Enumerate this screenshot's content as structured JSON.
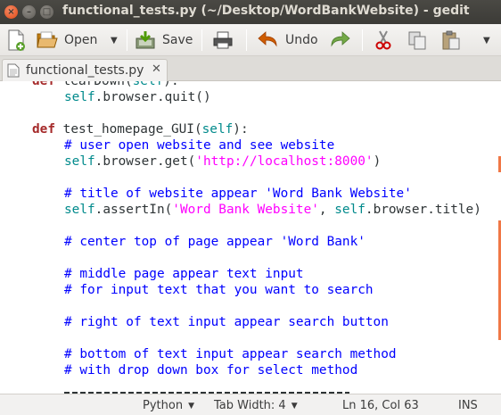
{
  "window": {
    "title": "functional_tests.py (~/Desktop/WordBankWebsite) - gedit"
  },
  "toolbar": {
    "open_label": "Open",
    "save_label": "Save",
    "undo_label": "Undo"
  },
  "tab": {
    "label": "functional_tests.py",
    "close": "✕"
  },
  "code": {
    "l0_kw": "def",
    "l0_name": " tearDown(",
    "l0_self": "self",
    "l0_end": "):",
    "l1_self": "self",
    "l1_rest": ".browser.quit()",
    "l3_kw": "def",
    "l3_name": " test_homepage_GUI(",
    "l3_self": "self",
    "l3_end": "):",
    "l4_comment": "# user open website and see website",
    "l5_self": "self",
    "l5_call": ".browser.get(",
    "l5_str": "'http://localhost:8000'",
    "l5_end": ")",
    "l7_comment": "# title of website appear 'Word Bank Website'",
    "l8_self": "self",
    "l8_call": ".assertIn(",
    "l8_str": "'Word Bank Website'",
    "l8_sep": ", ",
    "l8_self2": "self",
    "l8_end": ".browser.title)",
    "l10_comment": "# center top of page appear 'Word Bank'",
    "l12_comment": "# middle page appear text input",
    "l13_comment": "# for input text that you want to search",
    "l15_comment": "# right of text input appear search button",
    "l17_comment": "# bottom of text input appear search method",
    "l18_comment": "# with drop down box for select method"
  },
  "status": {
    "language": "Python",
    "tab_width": "Tab Width: 4",
    "position": "Ln 16, Col 63",
    "mode": "INS"
  },
  "colors": {
    "keyword": "#a52a2a",
    "self": "#008a8c",
    "comment": "#0000ff",
    "string": "#ff00ff",
    "change_marker": "#f07746"
  }
}
